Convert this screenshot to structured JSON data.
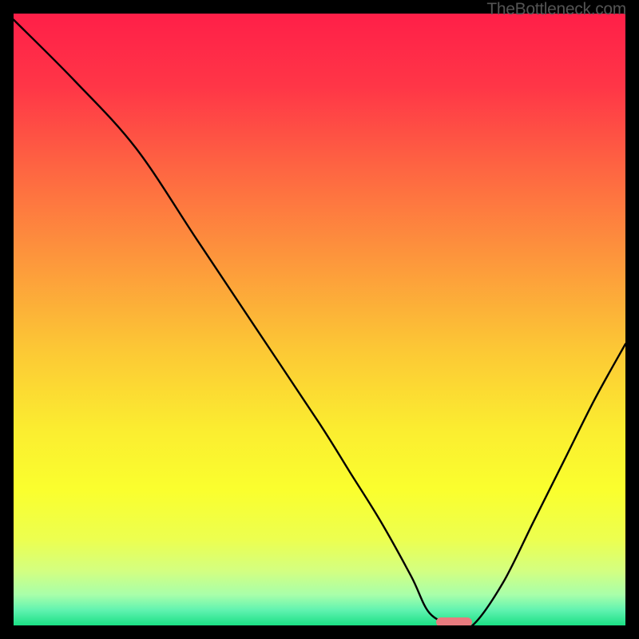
{
  "watermark": "TheBottleneck.com",
  "chart_data": {
    "type": "line",
    "title": "",
    "xlabel": "",
    "ylabel": "",
    "xlim": [
      0,
      100
    ],
    "ylim": [
      0,
      100
    ],
    "grid": false,
    "legend": false,
    "series": [
      {
        "name": "bottleneck-curve",
        "x": [
          0,
          10,
          20,
          30,
          40,
          50,
          55,
          60,
          65,
          68,
          72,
          75,
          80,
          85,
          90,
          95,
          100
        ],
        "y": [
          99,
          89,
          78,
          63,
          48,
          33,
          25,
          17,
          8,
          2,
          0,
          0,
          7,
          17,
          27,
          37,
          46
        ]
      }
    ],
    "marker": {
      "x_center": 72,
      "y_center": 0.5,
      "width_pct": 6,
      "height_pct": 1.5,
      "color": "#e87b7f"
    },
    "gradient_stops": [
      {
        "offset": 0.0,
        "color": "#ff1f48"
      },
      {
        "offset": 0.12,
        "color": "#ff3647"
      },
      {
        "offset": 0.25,
        "color": "#fe6442"
      },
      {
        "offset": 0.4,
        "color": "#fd963c"
      },
      {
        "offset": 0.55,
        "color": "#fcc835"
      },
      {
        "offset": 0.68,
        "color": "#fbed30"
      },
      {
        "offset": 0.78,
        "color": "#faff2e"
      },
      {
        "offset": 0.86,
        "color": "#ecff50"
      },
      {
        "offset": 0.91,
        "color": "#d4ff80"
      },
      {
        "offset": 0.95,
        "color": "#a8ffaa"
      },
      {
        "offset": 0.975,
        "color": "#60f3b0"
      },
      {
        "offset": 1.0,
        "color": "#1be085"
      }
    ]
  }
}
